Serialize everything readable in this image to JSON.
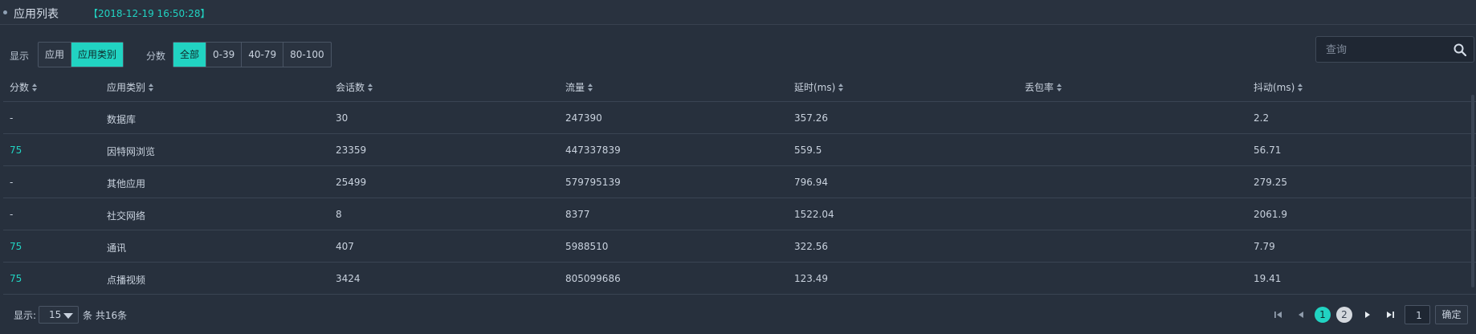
{
  "header": {
    "title": "应用列表",
    "timestamp": "【2018-12-19 16:50:28】"
  },
  "toolbar": {
    "display_label": "显示",
    "display_options": [
      "应用",
      "应用类别"
    ],
    "display_selected": "应用类别",
    "score_label": "分数",
    "score_options": [
      "全部",
      "0-39",
      "40-79",
      "80-100"
    ],
    "score_selected": "全部"
  },
  "search": {
    "placeholder": "查询",
    "value": "",
    "icon": "search-icon"
  },
  "table": {
    "columns": [
      "分数",
      "应用类别",
      "会话数",
      "流量",
      "延时(ms)",
      "丢包率",
      "抖动(ms)"
    ],
    "rows": [
      [
        "-",
        "数据库",
        "30",
        "247390",
        "357.26",
        "",
        "2.2"
      ],
      [
        "75",
        "因特网浏览",
        "23359",
        "447337839",
        "559.5",
        "",
        "56.71"
      ],
      [
        "-",
        "其他应用",
        "25499",
        "579795139",
        "796.94",
        "",
        "279.25"
      ],
      [
        "-",
        "社交网络",
        "8",
        "8377",
        "1522.04",
        "",
        "2061.9"
      ],
      [
        "75",
        "通讯",
        "407",
        "5988510",
        "322.56",
        "",
        "7.79"
      ],
      [
        "75",
        "点播视频",
        "3424",
        "805099686",
        "123.49",
        "",
        "19.41"
      ]
    ]
  },
  "footer": {
    "show_label": "显示:",
    "page_size": "15",
    "total_label": "条 共16条",
    "pages": [
      "1",
      "2"
    ],
    "current_page": "1",
    "goto_value": "1",
    "confirm_label": "确定"
  },
  "colors": {
    "accent": "#21d3c2",
    "background": "#27303d",
    "text": "#c9d2de"
  }
}
